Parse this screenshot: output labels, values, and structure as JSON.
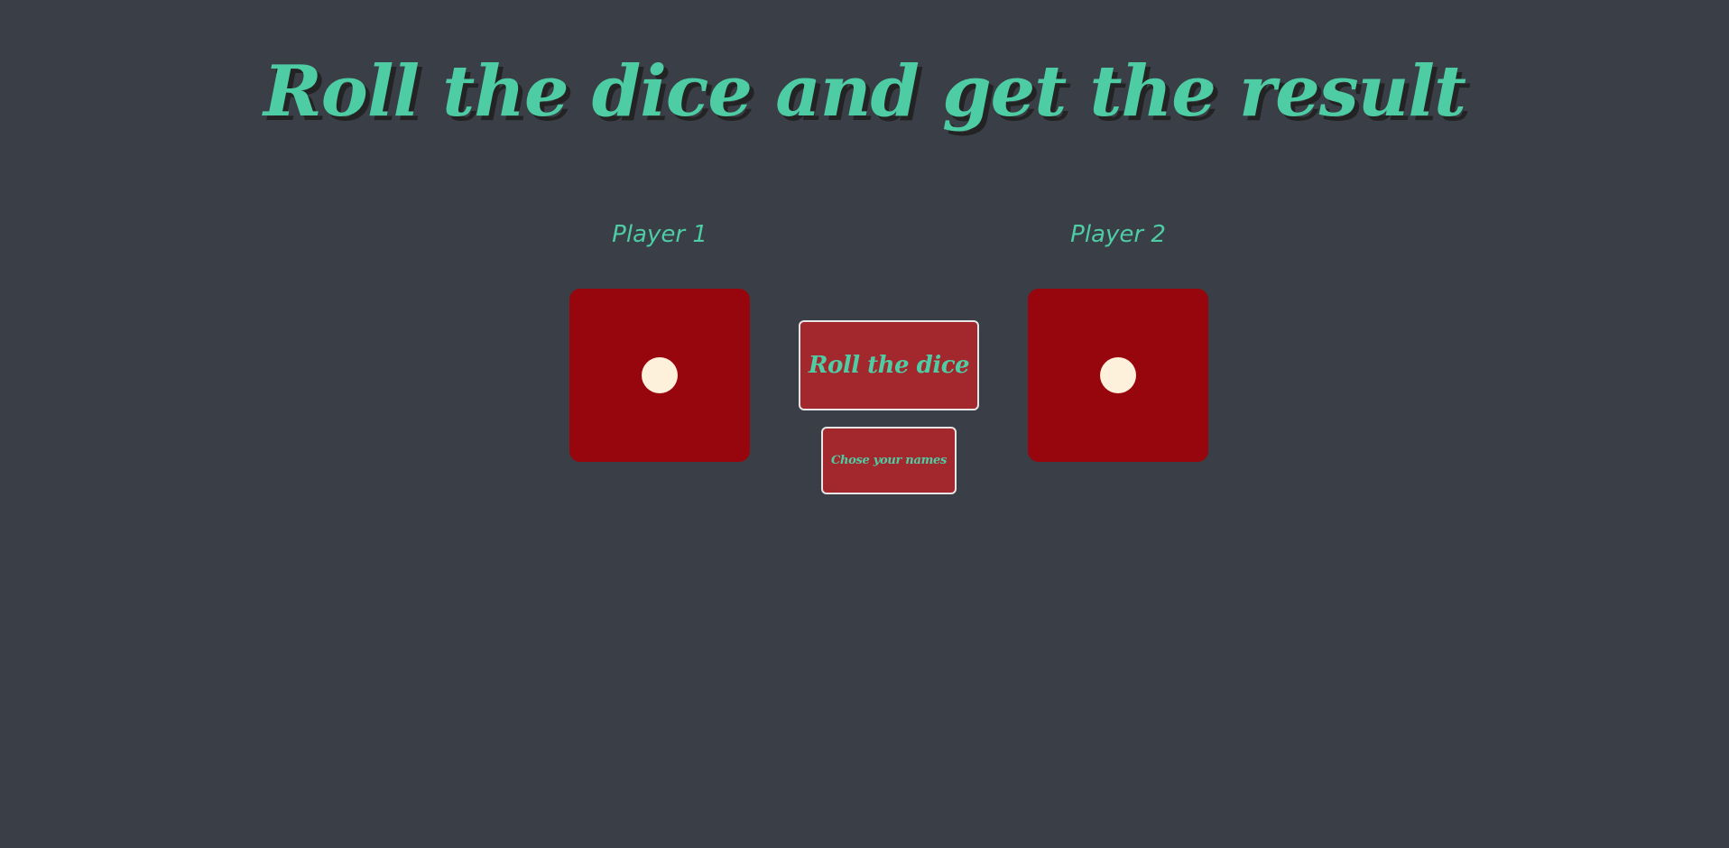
{
  "title": "Roll the dice and get the result",
  "players": [
    {
      "name": "Player 1",
      "die_value": 1
    },
    {
      "name": "Player 2",
      "die_value": 1
    }
  ],
  "buttons": {
    "roll_label": "Roll the dice",
    "names_label": "Chose your names"
  },
  "colors": {
    "background": "#393e47",
    "accent": "#4ecca3",
    "die": "#98060d",
    "pip": "#fdf1db",
    "button": "#a3282d"
  }
}
